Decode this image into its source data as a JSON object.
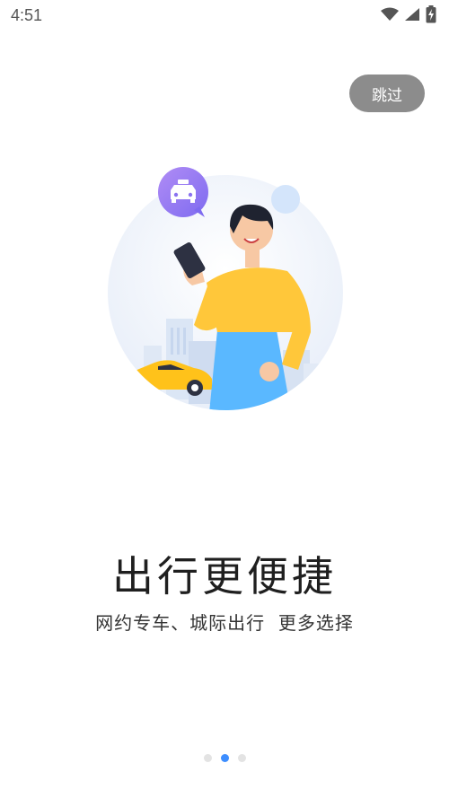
{
  "status_bar": {
    "time": "4:51",
    "icons": [
      "wifi-icon",
      "cell-signal-icon",
      "battery-charging-icon"
    ]
  },
  "skip_button": {
    "label": "跳过"
  },
  "illustration": {
    "subject": "person-with-phone-and-taxi",
    "badge_icon": "taxi-icon",
    "colors": {
      "badge": "#9b7bf0",
      "shirt": "#ffc73a",
      "pants": "#5ab8ff",
      "car": "#ffc21a",
      "circle": "#eef3fb"
    }
  },
  "onboarding": {
    "title": "出行更便捷",
    "subtitle": "网约专车、城际出行  更多选择"
  },
  "pager": {
    "page_count": 3,
    "active_index": 1,
    "active_color": "#3d8eff",
    "inactive_color": "#e3e3e3"
  }
}
